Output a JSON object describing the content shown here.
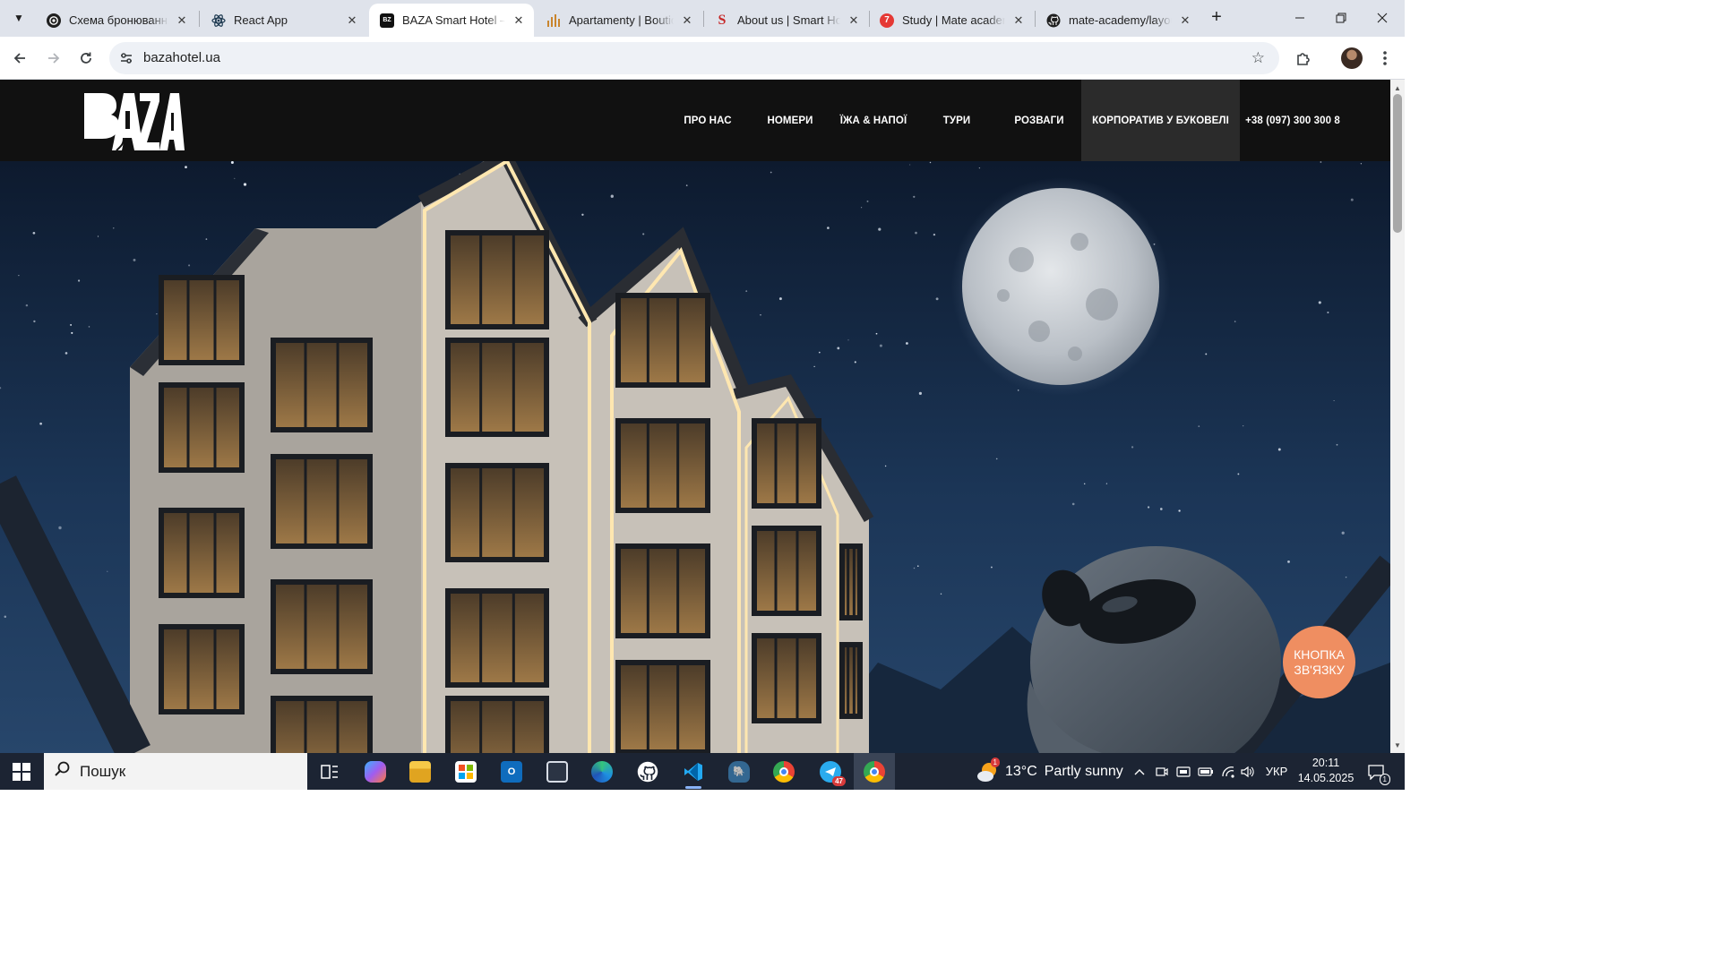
{
  "browser": {
    "tabs": [
      {
        "title": "Схема бронювання",
        "favicon": "openai-icon",
        "active": false
      },
      {
        "title": "React App",
        "favicon": "react-icon",
        "active": false
      },
      {
        "title": "BAZA Smart Hotel —",
        "favicon": "baza-icon",
        "active": true
      },
      {
        "title": "Apartamenty | Boutiq",
        "favicon": "bars-icon",
        "active": false
      },
      {
        "title": "About us | Smart Hot",
        "favicon": "s-icon",
        "active": false
      },
      {
        "title": "Study | Mate academ",
        "favicon": "mate-icon",
        "badge": "7",
        "active": false
      },
      {
        "title": "mate-academy/layou",
        "favicon": "github-icon",
        "active": false
      }
    ],
    "address": "bazahotel.ua"
  },
  "site": {
    "logo_text": "BAZA",
    "nav": [
      {
        "label": "ПРО НАС"
      },
      {
        "label": "НОМЕРИ"
      },
      {
        "label": "ЇЖА & НАПОЇ"
      },
      {
        "label": "ТУРИ"
      },
      {
        "label": "РОЗВАГИ"
      },
      {
        "label": "КОРПОРАТИВ У БУКОВЕЛІ",
        "highlighted": true
      },
      {
        "label": "+38 (097) 300 300 8"
      }
    ],
    "contact_button": "КНОПКА ЗВ'ЯЗКУ",
    "colors": {
      "header_bg": "#111111",
      "contact_button": "#ef8e61",
      "sky": "#1a3354"
    }
  },
  "taskbar": {
    "search_placeholder": "Пошук",
    "telegram_badge": "47",
    "weather": {
      "temp": "13°C",
      "desc": "Partly sunny",
      "badge": "1"
    },
    "language": "УКР",
    "time": "20:11",
    "date": "14.05.2025",
    "notifications": "1"
  }
}
